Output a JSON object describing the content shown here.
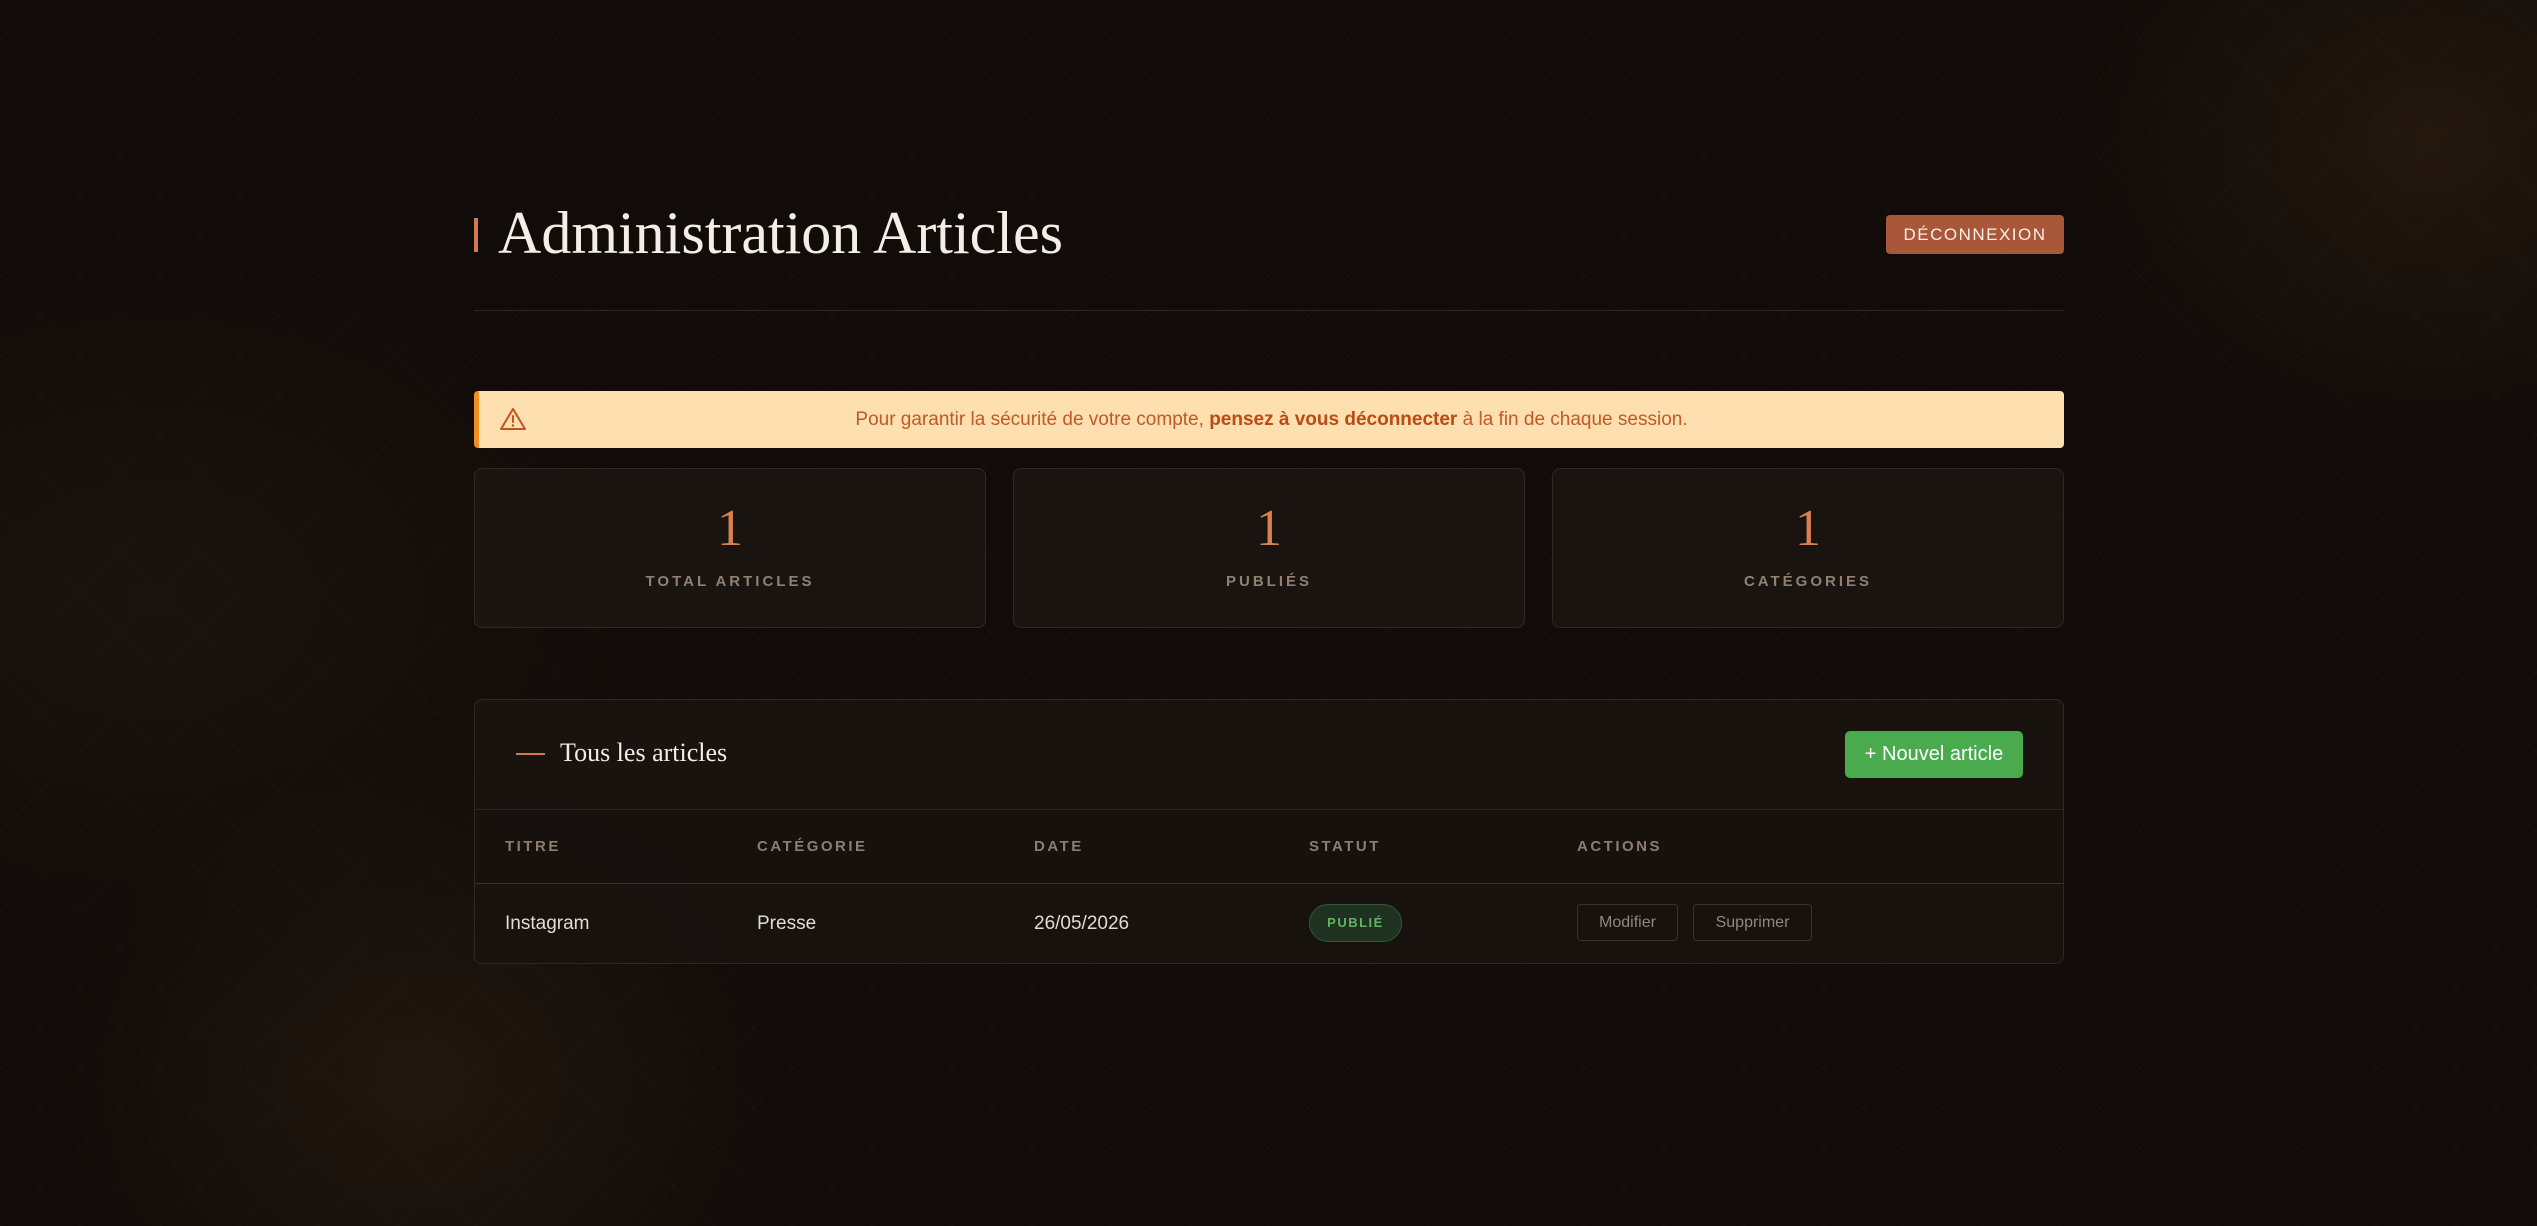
{
  "header": {
    "title": "Administration Articles",
    "logout_label": "DÉCONNEXION"
  },
  "alert": {
    "icon": "warning-triangle-icon",
    "text_before": "Pour garantir la sécurité de votre compte, ",
    "text_bold": "pensez à vous déconnecter",
    "text_after": " à la fin de chaque session."
  },
  "stats": [
    {
      "value": "1",
      "label": "TOTAL ARTICLES"
    },
    {
      "value": "1",
      "label": "PUBLIÉS"
    },
    {
      "value": "1",
      "label": "CATÉGORIES"
    }
  ],
  "articles": {
    "title": "Tous les articles",
    "new_label": "+ Nouvel article",
    "columns": [
      "TITRE",
      "CATÉGORIE",
      "DATE",
      "STATUT",
      "ACTIONS"
    ],
    "rows": [
      {
        "title": "Instagram",
        "category": "Presse",
        "date": "26/05/2026",
        "status": "PUBLIÉ",
        "edit_label": "Modifier",
        "delete_label": "Supprimer"
      }
    ]
  },
  "colors": {
    "background": "#110c09",
    "accent": "#d4794d",
    "logout": "#a9573b",
    "alert_bg": "#fddfb0",
    "alert_border": "#f38f22",
    "primary_button": "#4aaa4e",
    "status_published": "#5fb462"
  }
}
